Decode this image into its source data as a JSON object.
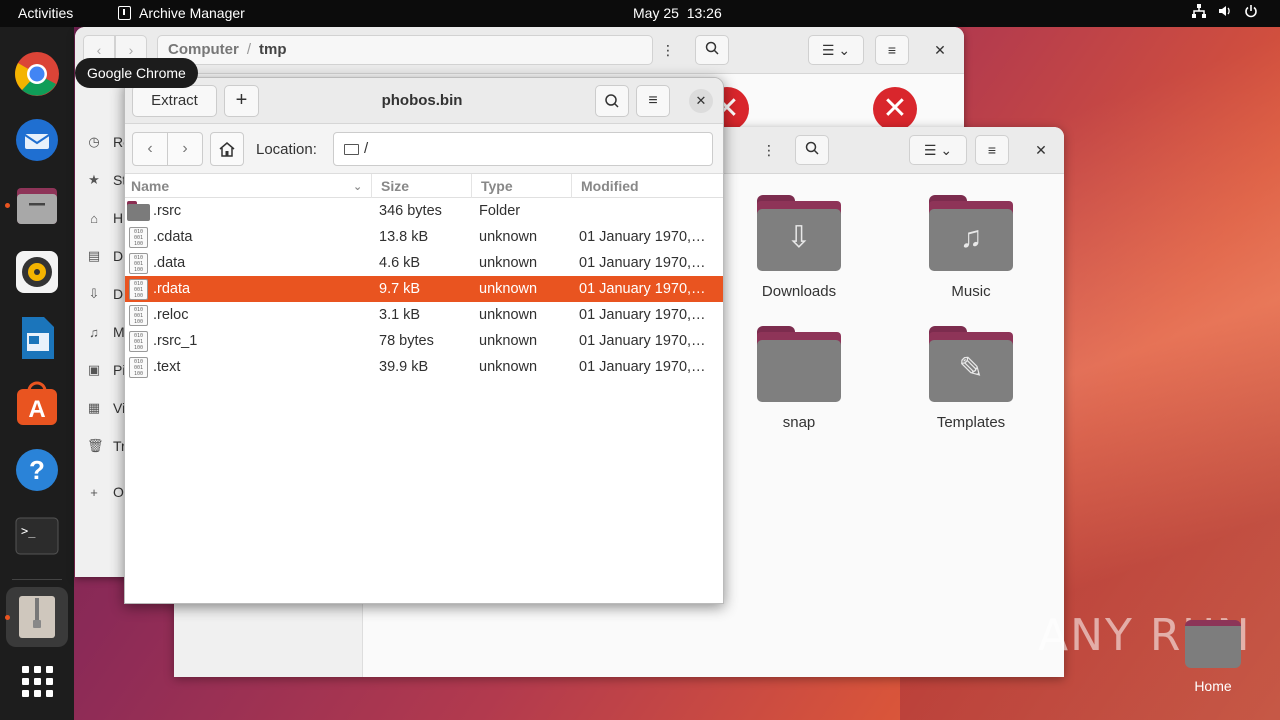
{
  "topbar": {
    "activities": "Activities",
    "app_name": "Archive Manager",
    "date": "May 25",
    "time": "13:26"
  },
  "dock": {
    "tooltip": "Google Chrome",
    "items": [
      "chrome-icon",
      "thunderbird-icon",
      "files-icon",
      "rhythmbox-icon",
      "writer-icon",
      "app-center-icon",
      "help-icon",
      "terminal-icon",
      "archive-manager-icon",
      "show-apps-icon"
    ]
  },
  "files_back": {
    "path_root": "Computer",
    "path_sep": "/",
    "path_current": "tmp",
    "sidebar": [
      "Re",
      "St",
      "H",
      "D",
      "D",
      "M",
      "Pi",
      "Vi",
      "Tr",
      "O"
    ]
  },
  "files_front": {
    "folders": [
      "Downloads",
      "Music",
      "snap",
      "Templates"
    ]
  },
  "archive": {
    "extract_label": "Extract",
    "add_label": "+",
    "title": "phobos.bin",
    "location_label": "Location:",
    "location_value": "/",
    "columns": [
      "Name",
      "Size",
      "Type",
      "Modified"
    ],
    "rows": [
      {
        "name": ".rsrc",
        "size": "346 bytes",
        "type": "Folder",
        "modified": "",
        "kind": "folder"
      },
      {
        "name": ".cdata",
        "size": "13.8 kB",
        "type": "unknown",
        "modified": "01 January 1970,…",
        "kind": "file"
      },
      {
        "name": ".data",
        "size": "4.6 kB",
        "type": "unknown",
        "modified": "01 January 1970,…",
        "kind": "file"
      },
      {
        "name": ".rdata",
        "size": "9.7 kB",
        "type": "unknown",
        "modified": "01 January 1970,…",
        "kind": "file",
        "selected": true
      },
      {
        "name": ".reloc",
        "size": "3.1 kB",
        "type": "unknown",
        "modified": "01 January 1970,…",
        "kind": "file"
      },
      {
        "name": ".rsrc_1",
        "size": "78 bytes",
        "type": "unknown",
        "modified": "01 January 1970,…",
        "kind": "file"
      },
      {
        "name": ".text",
        "size": "39.9 kB",
        "type": "unknown",
        "modified": "01 January 1970,…",
        "kind": "file"
      }
    ]
  },
  "desktop": {
    "home_label": "Home",
    "watermark": "ANY RUN"
  },
  "colors": {
    "accent": "#e95420",
    "topbar": "#0c0c0c",
    "dock": "#1d1d1d"
  }
}
